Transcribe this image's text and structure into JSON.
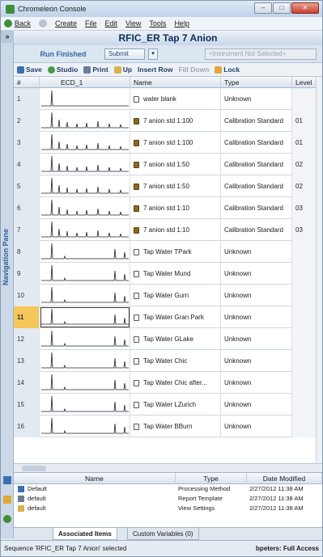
{
  "window": {
    "title": "Chromeleon Console"
  },
  "menu": {
    "back": "Back",
    "create": "Create",
    "file": "File",
    "edit": "Edit",
    "view": "View",
    "tools": "Tools",
    "help": "Help"
  },
  "nav_pane": {
    "toggle": "»",
    "label": "Navigation Pane"
  },
  "sequence": {
    "title": "RFIC_ER Tap 7 Anion",
    "status": "Run Finished",
    "submit_label": "Submit",
    "instrument_placeholder": "<Instrument Not Selected>"
  },
  "toolbar": {
    "save": "Save",
    "studio": "Studio",
    "print": "Print",
    "up": "Up",
    "insert_row": "Insert Row",
    "fill_down": "Fill Down",
    "lock": "Lock"
  },
  "columns": {
    "num": "#",
    "ecd": "ECD_1",
    "name": "Name",
    "type": "Type",
    "level": "Level"
  },
  "rows": [
    {
      "num": "1",
      "name": "water blank",
      "type": "Unknown",
      "level": "",
      "kind": "blank"
    },
    {
      "num": "2",
      "name": "7 anion std 1:100",
      "type": "Calibration Standard",
      "level": "01",
      "kind": "std"
    },
    {
      "num": "3",
      "name": "7 anion std 1:100",
      "type": "Calibration Standard",
      "level": "01",
      "kind": "std"
    },
    {
      "num": "4",
      "name": "7 anion std 1:50",
      "type": "Calibration Standard",
      "level": "02",
      "kind": "std"
    },
    {
      "num": "5",
      "name": "7 anion std 1:50",
      "type": "Calibration Standard",
      "level": "02",
      "kind": "std"
    },
    {
      "num": "6",
      "name": "7 anion std 1:10",
      "type": "Calibration Standard",
      "level": "03",
      "kind": "std"
    },
    {
      "num": "7",
      "name": "7 anion std 1:10",
      "type": "Calibration Standard",
      "level": "03",
      "kind": "std"
    },
    {
      "num": "8",
      "name": "Tap Water  TPark",
      "type": "Unknown",
      "level": "",
      "kind": "tap"
    },
    {
      "num": "9",
      "name": "Tap Water  Mund",
      "type": "Unknown",
      "level": "",
      "kind": "tap"
    },
    {
      "num": "10",
      "name": "Tap Water  Gurn",
      "type": "Unknown",
      "level": "",
      "kind": "tap"
    },
    {
      "num": "11",
      "name": "Tap Water  Gran Park",
      "type": "Unknown",
      "level": "",
      "kind": "tap"
    },
    {
      "num": "12",
      "name": "Tap Water  GLake",
      "type": "Unknown",
      "level": "",
      "kind": "tap"
    },
    {
      "num": "13",
      "name": "Tap Water  Chic",
      "type": "Unknown",
      "level": "",
      "kind": "tap"
    },
    {
      "num": "14",
      "name": "Tap Water  Chic after...",
      "type": "Unknown",
      "level": "",
      "kind": "tap"
    },
    {
      "num": "15",
      "name": "Tap Water  LZurich",
      "type": "Unknown",
      "level": "",
      "kind": "tap"
    },
    {
      "num": "16",
      "name": "Tap Water  BBurn",
      "type": "Unknown",
      "level": "",
      "kind": "tap"
    }
  ],
  "selected_row": "11",
  "items_panel": {
    "headers": {
      "name": "Name",
      "type": "Type",
      "date": "Date Modified"
    },
    "rows": [
      {
        "name": "Default",
        "type": "Processing Method",
        "date": "2/27/2012 11:38 AM"
      },
      {
        "name": "default",
        "type": "Report Template",
        "date": "2/27/2012 11:38 AM"
      },
      {
        "name": "default",
        "type": "View Settings",
        "date": "2/27/2012 11:38 AM"
      }
    ],
    "tabs": [
      "Associated Items",
      "Custom Variables (0)"
    ]
  },
  "status": {
    "left": "Sequence 'RFIC_ER Tap 7 Anion' selected",
    "right": "bpeters: Full Access"
  },
  "colors": {
    "accent": "#2c5f99",
    "selected": "#f5c75a",
    "close": "#c7402d"
  }
}
